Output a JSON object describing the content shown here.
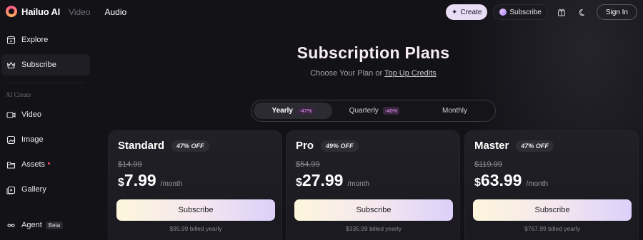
{
  "header": {
    "logo_text": "Hailuo AI",
    "nav": [
      {
        "label": "Video",
        "active": false
      },
      {
        "label": "Audio",
        "active": true
      }
    ],
    "create_label": "Create",
    "subscribe_label": "Subscribe",
    "signin_label": "Sign In"
  },
  "sidebar": {
    "items": [
      {
        "label": "Explore",
        "icon": "explore-icon"
      },
      {
        "label": "Subscribe",
        "icon": "crown-icon",
        "active": true
      }
    ],
    "section_label": "AI Create",
    "create_items": [
      {
        "label": "Video",
        "icon": "video-icon"
      },
      {
        "label": "Image",
        "icon": "image-icon"
      },
      {
        "label": "Assets",
        "icon": "folder-icon",
        "dot": true
      },
      {
        "label": "Gallery",
        "icon": "gallery-icon"
      }
    ],
    "agent": {
      "label": "Agent",
      "badge": "Beta",
      "icon": "infinity-icon"
    }
  },
  "main": {
    "title": "Subscription Plans",
    "subtitle_prefix": "Choose Your Plan or",
    "subtitle_link": "Top Up Credits",
    "billing_tabs": [
      {
        "label": "Yearly",
        "badge": "-47%",
        "active": true
      },
      {
        "label": "Quarterly",
        "badge": "-40%",
        "active": false
      },
      {
        "label": "Monthly",
        "badge": "",
        "active": false
      }
    ],
    "plans": [
      {
        "name": "Standard",
        "off": "47% OFF",
        "old_price": "$14.99",
        "currency": "$",
        "price": "7.99",
        "per": "/month",
        "button": "Subscribe",
        "billed": "$95.99 billed yearly"
      },
      {
        "name": "Pro",
        "off": "49% OFF",
        "old_price": "$54.99",
        "currency": "$",
        "price": "27.99",
        "per": "/month",
        "button": "Subscribe",
        "billed": "$335.99 billed yearly"
      },
      {
        "name": "Master",
        "off": "47% OFF",
        "old_price": "$119.99",
        "currency": "$",
        "price": "63.99",
        "per": "/month",
        "button": "Subscribe",
        "billed": "$767.99 billed yearly"
      }
    ]
  },
  "colors": {
    "background": "#131217",
    "card": "#1e1d23",
    "accent_badge": "#e79cff",
    "create_button": "#e9dcf5"
  }
}
